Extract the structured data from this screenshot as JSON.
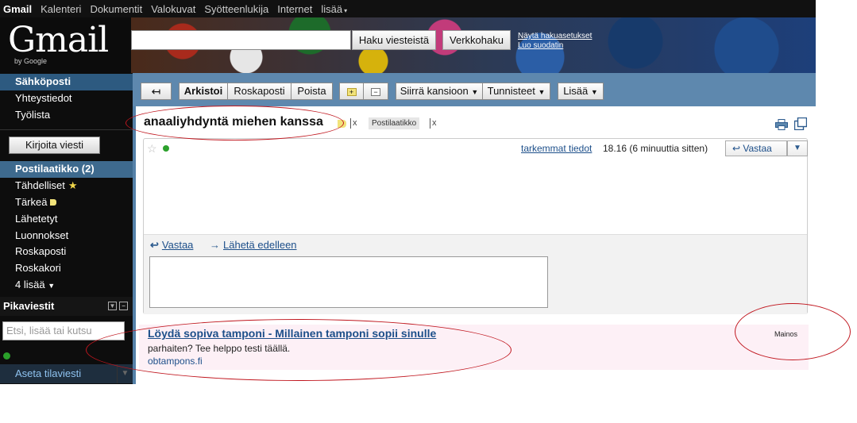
{
  "topbar": {
    "items": [
      "Gmail",
      "Kalenteri",
      "Dokumentit",
      "Valokuvat",
      "Syötteenlukija",
      "Internet",
      "lisää"
    ]
  },
  "header": {
    "logo_text": "Gmail",
    "logo_by": "by Google",
    "search_mail_label": "Haku viesteistä",
    "web_search_label": "Verkkohaku",
    "show_search_options": "Näytä hakuasetukset",
    "create_filter": "Luo suodatin"
  },
  "sidebar": {
    "sections": [
      "Sähköposti",
      "Yhteystiedot",
      "Työlista"
    ],
    "compose_label": "Kirjoita viesti",
    "folders": [
      "Postilaatikko (2)",
      "Tähdelliset",
      "Tärkeä",
      "Lähetetyt",
      "Luonnokset",
      "Roskaposti",
      "Roskakori",
      "4 lisää"
    ],
    "chat_title": "Pikaviestit",
    "chat_search_placeholder": "Etsi, lisää tai kutsu",
    "status_label": "Aseta tilaviesti"
  },
  "toolbar": {
    "back_icon": "back-arrow-icon",
    "archive": "Arkistoi",
    "spam": "Roskaposti",
    "delete": "Poista",
    "move_to": "Siirrä kansioon",
    "labels": "Tunnisteet",
    "more": "Lisää"
  },
  "message": {
    "subject": "anaaliyhdyntä miehen kanssa",
    "tag_label": "Postilaatikko",
    "tag_close": "x",
    "details_link": "tarkemmat tiedot",
    "time": "18.16 (6 minuuttia sitten)",
    "reply_button": "Vastaa",
    "reply_link": "Vastaa",
    "forward_link": "Lähetä edelleen"
  },
  "ad": {
    "title": "Löydä sopiva tamponi - Millainen tamponi sopii sinulle",
    "text": "parhaiten? Tee helppo testi täällä.",
    "url": "obtampons.fi",
    "label": "Mainos"
  },
  "colors": {
    "nav_selected": "#2d5a80",
    "toolbar_bg": "#5e88ae",
    "link": "#1d4f8a",
    "annotation_red": "#c0161e",
    "ad_bg": "#fdf0f6"
  }
}
